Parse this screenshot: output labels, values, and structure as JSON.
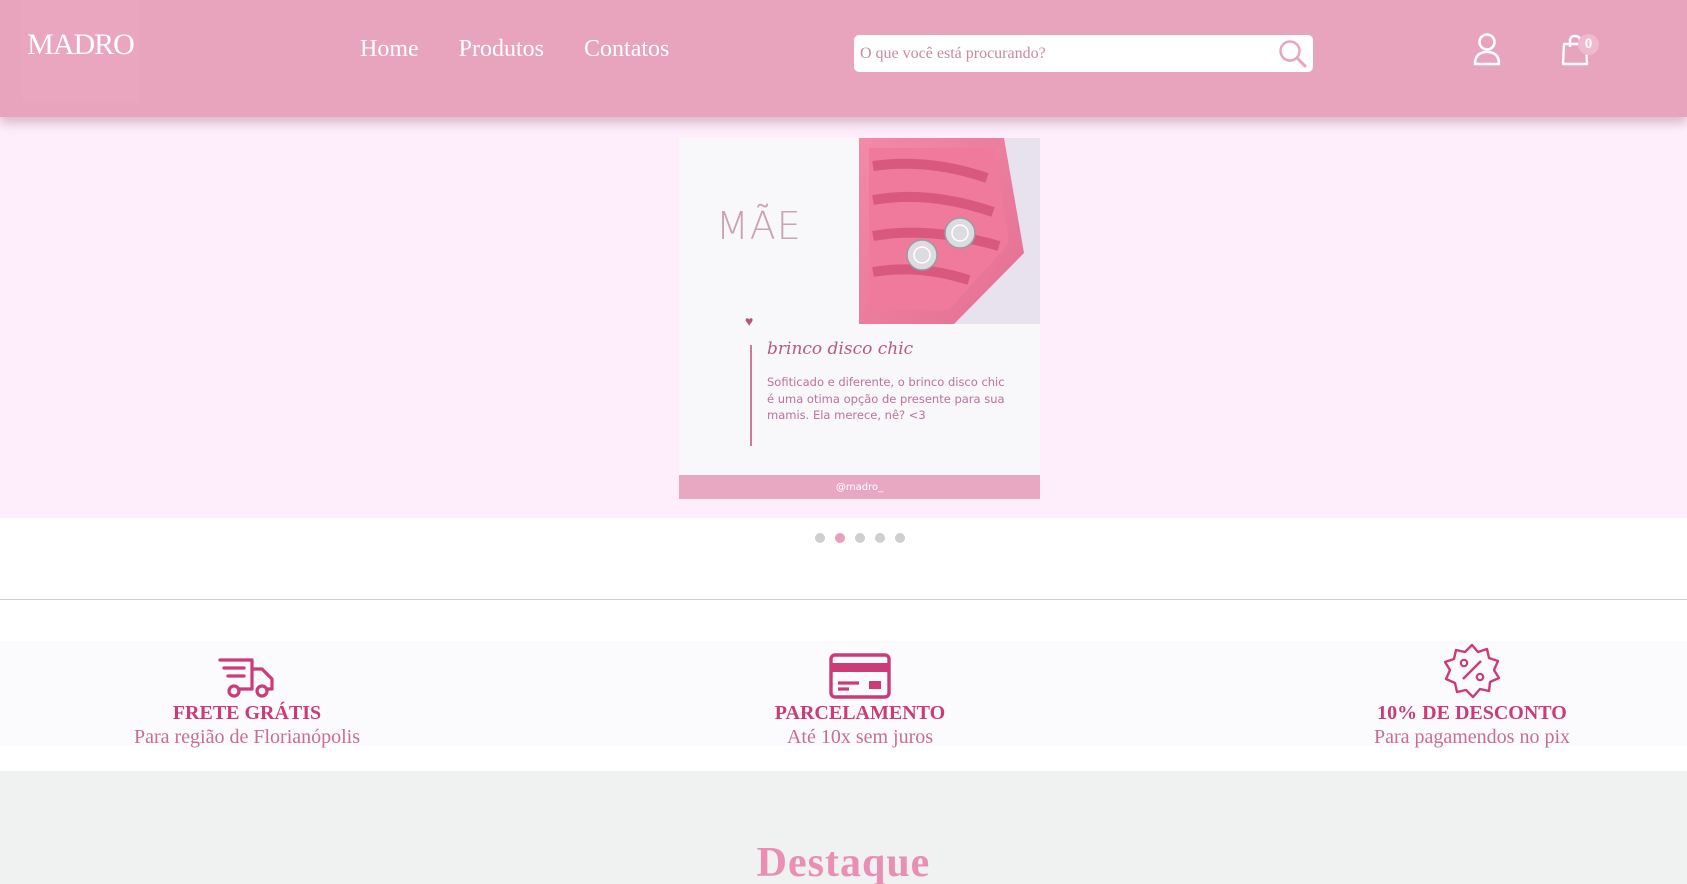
{
  "header": {
    "logo": "MADRO",
    "nav": [
      "Home",
      "Produtos",
      "Contatos"
    ],
    "search_placeholder": "O que você está procurando?",
    "cart_count": "0"
  },
  "banner": {
    "heading": "MÃE",
    "product_title": "brinco disco chic",
    "description": "Sofiticado e diferente, o brinco disco chic é uma otima opção de presente para sua mamis. Ela merece, nê? <3",
    "handle": "@madro_",
    "slide_count": 5,
    "active_slide": 2
  },
  "benefits": [
    {
      "icon": "truck-icon",
      "title": "FRETE GRÁTIS",
      "subtitle": "Para região de Florianópolis"
    },
    {
      "icon": "credit-card-icon",
      "title": "PARCELAMENTO",
      "subtitle": "Até 10x sem juros"
    },
    {
      "icon": "discount-badge-icon",
      "title": "10% DE DESCONTO",
      "subtitle": "Para pagamendos no pix"
    }
  ],
  "featured": {
    "title": "Destaque"
  },
  "colors": {
    "header_bg": "#e8a3bd",
    "accent": "#cc3a7a",
    "banner_bg": "#feeefc"
  }
}
